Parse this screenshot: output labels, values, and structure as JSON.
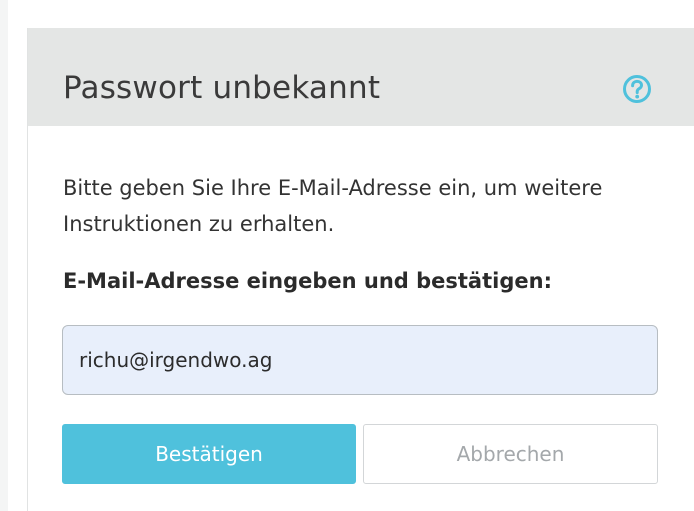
{
  "dialog": {
    "title": "Passwort unbekannt",
    "help_icon": "question-circle-icon",
    "intro_text": "Bitte geben Sie Ihre E-Mail-Adresse ein, um weitere Instruktionen zu erhalten.",
    "field_label": "E-Mail-Adresse eingeben und bestätigen:",
    "email_value": "richu@irgendwo.ag",
    "confirm_label": "Bestätigen",
    "cancel_label": "Abbrechen"
  },
  "colors": {
    "header_bg": "#e4e6e5",
    "accent": "#4fc1dc",
    "input_bg": "#e8effb",
    "help_icon": "#4fc1dc"
  }
}
